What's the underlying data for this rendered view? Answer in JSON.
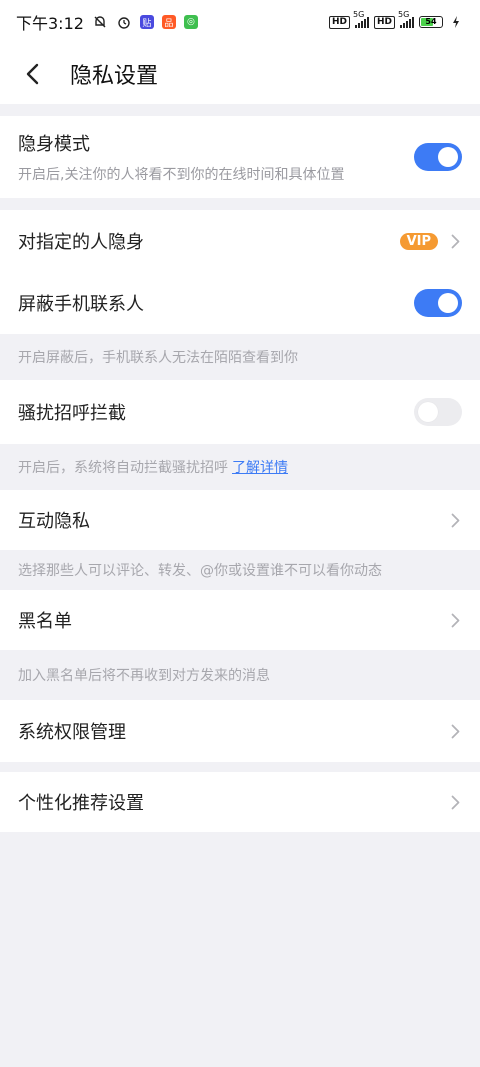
{
  "status_bar": {
    "time": "下午3:12",
    "network1": "5G",
    "network2": "5G",
    "hd1": "HD",
    "hd2": "HD",
    "battery": "54",
    "icons": [
      "mute-bell-icon",
      "alarm-icon",
      "app-icon-1",
      "app-icon-2",
      "app-icon-3"
    ]
  },
  "header": {
    "title": "隐私设置"
  },
  "stealth": {
    "title": "隐身模式",
    "subtitle": "开启后,关注你的人将看不到你的在线时间和具体位置",
    "enabled": true
  },
  "specific_stealth": {
    "title": "对指定的人隐身",
    "badge": "VIP"
  },
  "block_contacts": {
    "title": "屏蔽手机联系人",
    "enabled": true,
    "note": "开启屏蔽后，手机联系人无法在陌陌查看到你"
  },
  "harass_block": {
    "title": "骚扰招呼拦截",
    "enabled": false,
    "note": "开启后，系统将自动拦截骚扰招呼",
    "link": "了解详情"
  },
  "interaction_privacy": {
    "title": "互动隐私",
    "note": "选择那些人可以评论、转发、@你或设置谁不可以看你动态"
  },
  "blacklist": {
    "title": "黑名单",
    "note": "加入黑名单后将不再收到对方发来的消息"
  },
  "system_permissions": {
    "title": "系统权限管理"
  },
  "personalized": {
    "title": "个性化推荐设置"
  },
  "colors": {
    "accent": "#3d7bf5",
    "vip": "#f59a32",
    "background": "#f1f1f5"
  }
}
